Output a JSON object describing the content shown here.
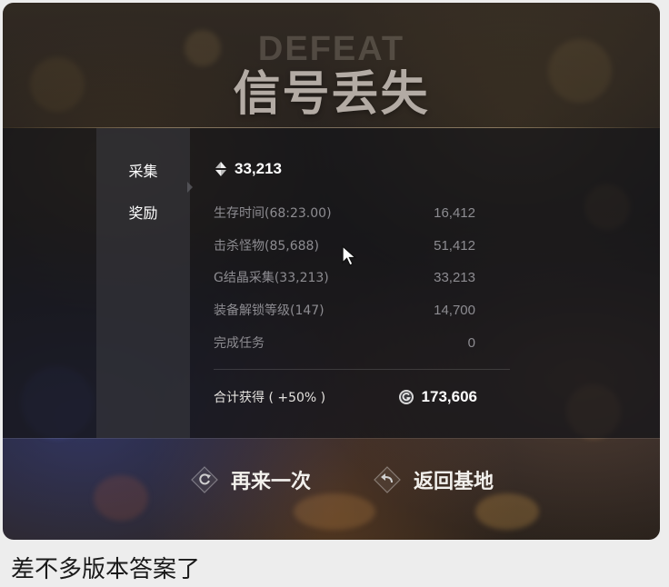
{
  "screen": {
    "ghost_title": "DEFEAT",
    "title": "信号丢失"
  },
  "tabs": [
    {
      "label": "采集",
      "active": true
    },
    {
      "label": "奖励",
      "active": false
    }
  ],
  "collection": {
    "icon": "crystal-icon",
    "value": "33,213"
  },
  "stats": [
    {
      "label": "生存时间(68:23.00)",
      "value": "16,412"
    },
    {
      "label": "击杀怪物(85,688)",
      "value": "51,412"
    },
    {
      "label": "G结晶采集(33,213)",
      "value": "33,213"
    },
    {
      "label": "装备解锁等级(147)",
      "value": "14,700"
    },
    {
      "label": "完成任务",
      "value": "0"
    }
  ],
  "total": {
    "label": "合计获得 ( +50% )",
    "currency_icon": "g-coin-icon",
    "value": "173,606"
  },
  "actions": [
    {
      "label": "再来一次",
      "icon": "retry-icon"
    },
    {
      "label": "返回基地",
      "icon": "back-icon"
    }
  ],
  "caption": "差不多版本答案了",
  "colors": {
    "title": "#b3aba4",
    "stat_text": "#8d8c91",
    "highlight": "#ffffff",
    "page_bg": "#ededed"
  }
}
